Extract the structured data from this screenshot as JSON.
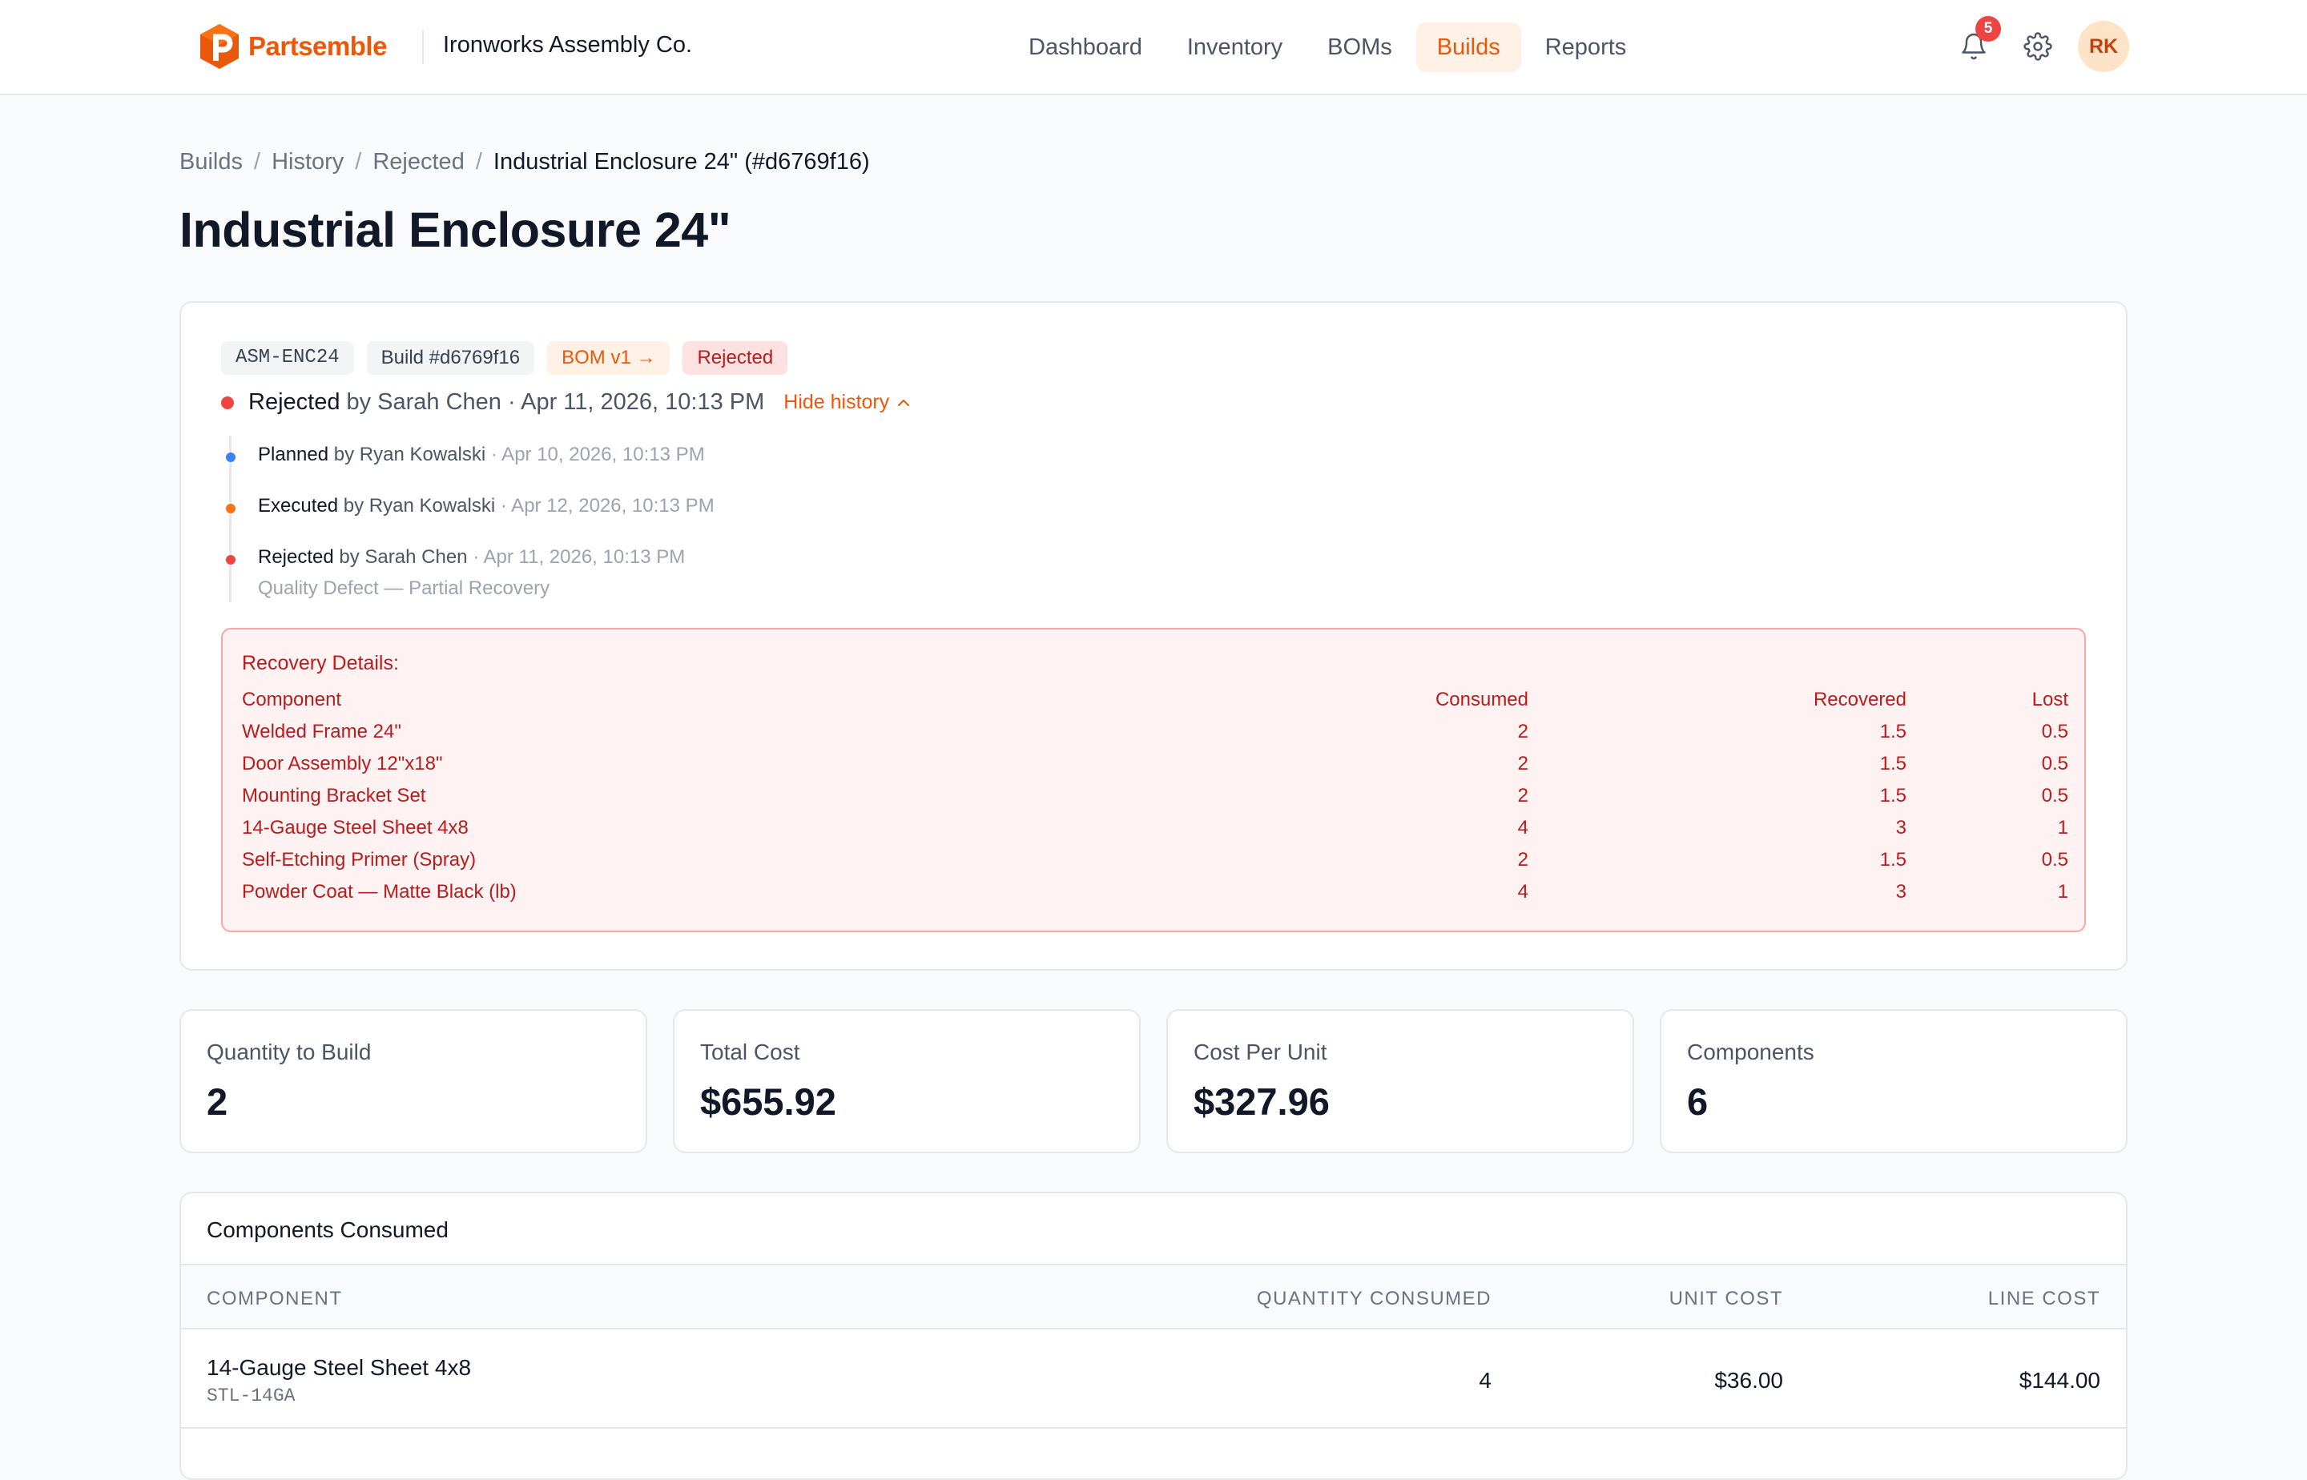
{
  "brand": {
    "name": "Partsemble",
    "color": "#ea580c"
  },
  "org": {
    "name": "Ironworks Assembly Co."
  },
  "nav": {
    "items": [
      {
        "label": "Dashboard"
      },
      {
        "label": "Inventory"
      },
      {
        "label": "BOMs"
      },
      {
        "label": "Builds"
      },
      {
        "label": "Reports"
      }
    ],
    "active": "Builds",
    "notifications_count": "5",
    "user_initials": "RK"
  },
  "breadcrumb": {
    "items": [
      "Builds",
      "History",
      "Rejected"
    ],
    "current": "Industrial Enclosure 24\" (#d6769f16)"
  },
  "page_title": "Industrial Enclosure 24\"",
  "build": {
    "tags": {
      "sku": "ASM-ENC24",
      "build_id": "Build #d6769f16",
      "bom": "BOM v1 →",
      "status": "Rejected"
    },
    "status_line": {
      "status": "Rejected",
      "meta": "by Sarah Chen · Apr 11, 2026, 10:13 PM",
      "toggle_label": "Hide history"
    },
    "history": [
      {
        "action": "Planned",
        "by": "by Ryan Kowalski",
        "date": "· Apr 10, 2026, 10:13 PM",
        "color": "#3b82f6",
        "note": ""
      },
      {
        "action": "Executed",
        "by": "by Ryan Kowalski",
        "date": "· Apr 12, 2026, 10:13 PM",
        "color": "#f97316",
        "note": ""
      },
      {
        "action": "Rejected",
        "by": "by Sarah Chen",
        "date": "· Apr 11, 2026, 10:13 PM",
        "color": "#ef4444",
        "note": "Quality Defect — Partial Recovery"
      }
    ],
    "recovery": {
      "title": "Recovery Details:",
      "headers": {
        "component": "Component",
        "consumed": "Consumed",
        "recovered": "Recovered",
        "lost": "Lost"
      },
      "rows": [
        {
          "component": "Welded Frame 24\"",
          "consumed": "2",
          "recovered": "1.5",
          "lost": "0.5"
        },
        {
          "component": "Door Assembly 12\"x18\"",
          "consumed": "2",
          "recovered": "1.5",
          "lost": "0.5"
        },
        {
          "component": "Mounting Bracket Set",
          "consumed": "2",
          "recovered": "1.5",
          "lost": "0.5"
        },
        {
          "component": "14-Gauge Steel Sheet 4x8",
          "consumed": "4",
          "recovered": "3",
          "lost": "1"
        },
        {
          "component": "Self-Etching Primer (Spray)",
          "consumed": "2",
          "recovered": "1.5",
          "lost": "0.5"
        },
        {
          "component": "Powder Coat — Matte Black (lb)",
          "consumed": "4",
          "recovered": "3",
          "lost": "1"
        }
      ]
    }
  },
  "stats": [
    {
      "label": "Quantity to Build",
      "value": "2"
    },
    {
      "label": "Total Cost",
      "value": "$655.92"
    },
    {
      "label": "Cost Per Unit",
      "value": "$327.96"
    },
    {
      "label": "Components",
      "value": "6"
    }
  ],
  "components_consumed": {
    "title": "Components Consumed",
    "headers": {
      "component": "COMPONENT",
      "quantity": "QUANTITY CONSUMED",
      "unit_cost": "UNIT COST",
      "line_cost": "LINE COST"
    },
    "rows": [
      {
        "name": "14-Gauge Steel Sheet 4x8",
        "sku": "STL-14GA",
        "quantity": "4",
        "unit_cost": "$36.00",
        "line_cost": "$144.00"
      }
    ]
  }
}
